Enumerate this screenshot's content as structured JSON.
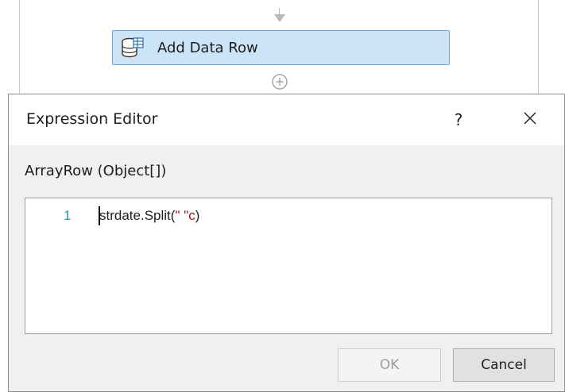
{
  "designer": {
    "activity_label": "Add Data Row",
    "icons": {
      "activity": "data-table-icon",
      "arrow": "arrow-down-icon",
      "add": "plus-circle-icon"
    }
  },
  "dialog": {
    "title": "Expression Editor",
    "help_label": "?",
    "argument_label": "ArrayRow (Object[])",
    "editor": {
      "line_number": "1",
      "code_prefix": "strdate.Split(",
      "code_string": "\" \"c",
      "code_suffix": ")"
    },
    "ok_label": "OK",
    "cancel_label": "Cancel",
    "ok_enabled": false
  },
  "colors": {
    "activity_bg": "#cce4f7",
    "activity_border": "#6aa6d6",
    "line_number": "#2b91af",
    "string_literal": "#a31515"
  }
}
